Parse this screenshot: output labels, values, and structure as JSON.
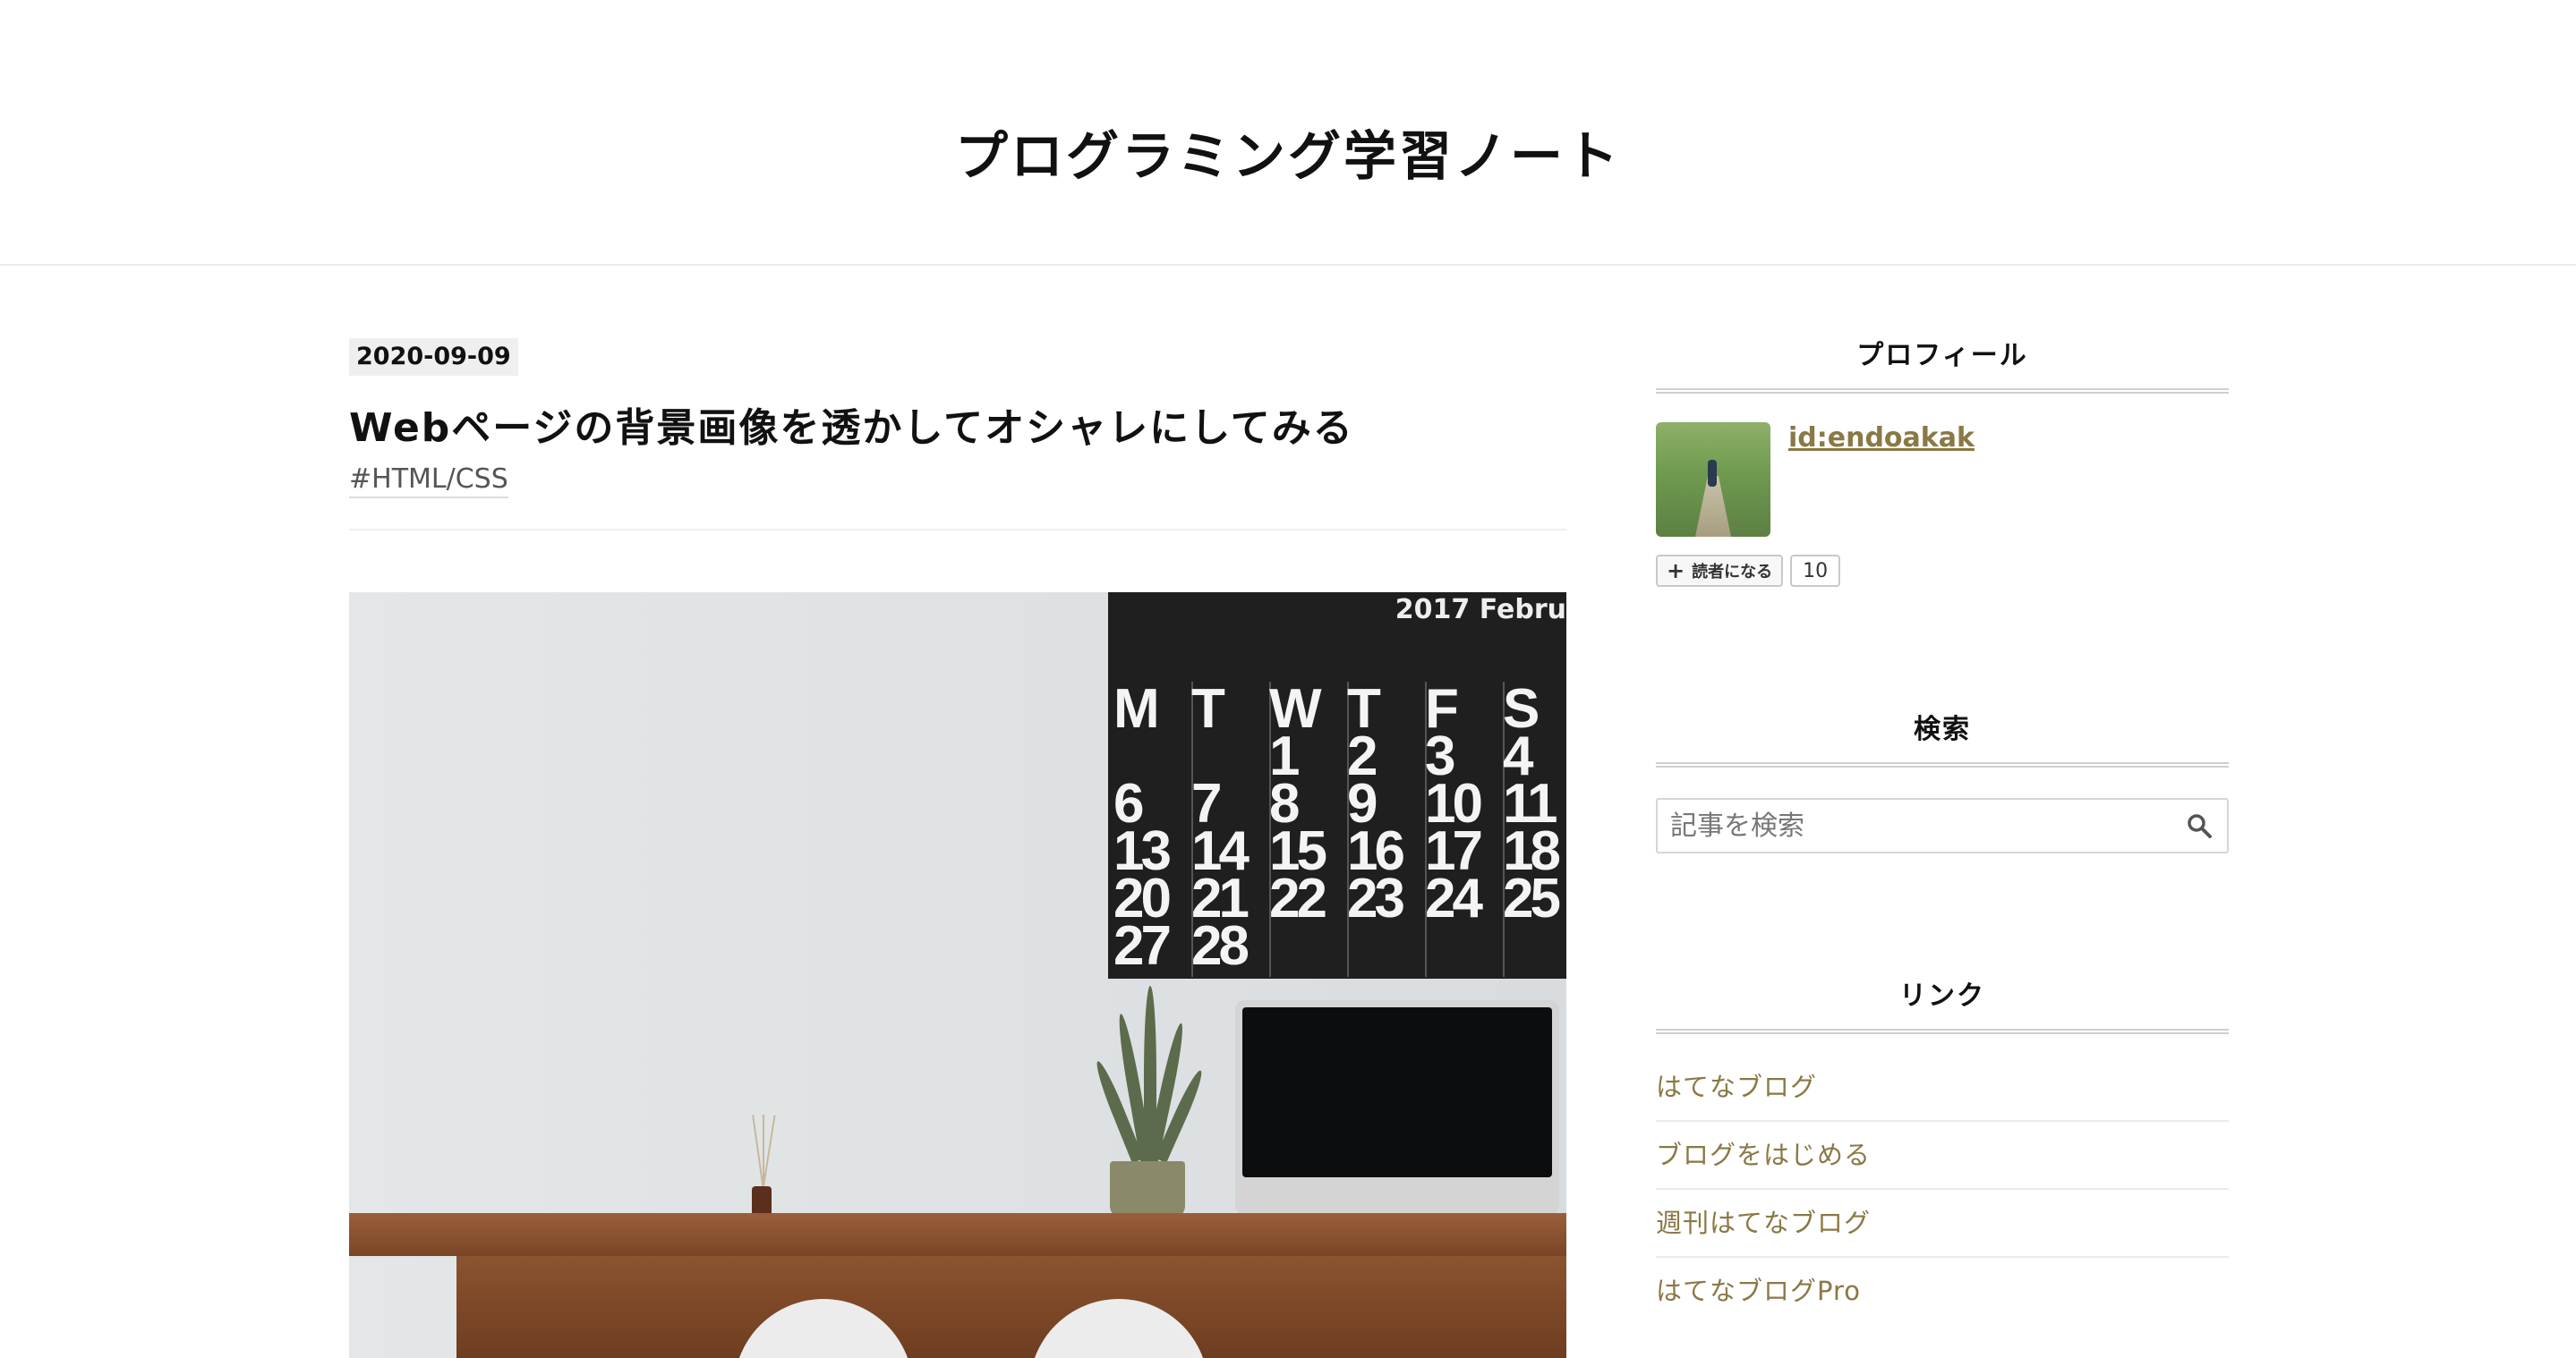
{
  "blog": {
    "title": "プログラミング学習ノート"
  },
  "entry": {
    "date": "2020-09-09",
    "title": "Webページの背景画像を透かしてオシャレにしてみる",
    "category": "#HTML/CSS"
  },
  "photo": {
    "calendar_header": "2017  Febru",
    "calendar_cells": [
      "M",
      "T",
      "W",
      "T",
      "F",
      "S",
      "",
      "",
      "1",
      "2",
      "3",
      "4",
      "6",
      "7",
      "8",
      "9",
      "10",
      "11",
      "13",
      "14",
      "15",
      "16",
      "17",
      "18",
      "20",
      "21",
      "22",
      "23",
      "24",
      "25",
      "27",
      "28",
      "",
      "",
      "",
      ""
    ]
  },
  "sidebar": {
    "profile": {
      "title": "プロフィール",
      "user_id": "id:endoakak",
      "subscribe_label": "読者になる",
      "subscriber_count": "10"
    },
    "search": {
      "title": "検索",
      "placeholder": "記事を検索"
    },
    "links": {
      "title": "リンク",
      "items": [
        "はてなブログ",
        "ブログをはじめる",
        "週刊はてなブログ",
        "はてなブログPro"
      ]
    }
  },
  "icons": {
    "search": "search-icon",
    "plus": "plus-icon"
  }
}
